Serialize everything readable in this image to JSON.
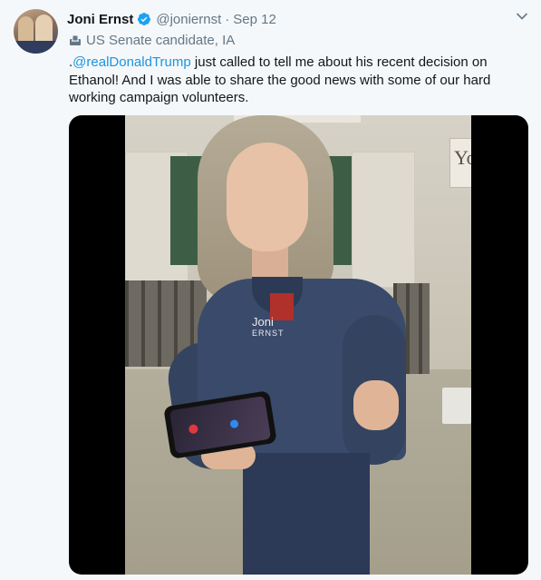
{
  "tweet": {
    "author_name": "Joni Ernst",
    "author_handle": "@joniernst",
    "separator": "·",
    "date": "Sep 12",
    "label": "US Senate candidate, IA",
    "text_prefix": ".",
    "mention": "@realDonaldTrump",
    "text_body": " just called to tell me about his recent decision on Ethanol! And I was able to share the good news with some of our hard working campaign volunteers.",
    "media": {
      "sign_text": "Yo",
      "logo_line1": "Joni",
      "logo_line2": "ERNST"
    }
  },
  "icons": {
    "verified": "verified-badge-icon",
    "chevron": "chevron-down-icon",
    "label": "ballot-box-icon"
  },
  "colors": {
    "link": "#1b95e0",
    "verified": "#1da1f2",
    "secondary_text": "#657786",
    "background": "#f5f8fa"
  }
}
